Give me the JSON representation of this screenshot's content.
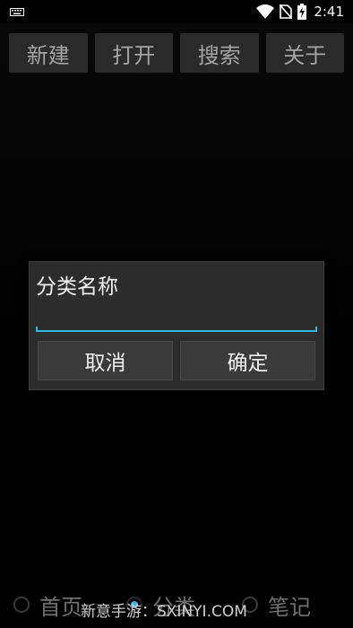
{
  "status_bar": {
    "time": "2:41",
    "icons": [
      "keyboard-icon",
      "wifi-icon",
      "no-sim-icon",
      "battery-charging-icon"
    ]
  },
  "toolbar": {
    "buttons": [
      {
        "label": "新建"
      },
      {
        "label": "打开"
      },
      {
        "label": "搜索"
      },
      {
        "label": "关于"
      }
    ]
  },
  "dialog": {
    "title": "分类名称",
    "input_value": "",
    "cancel_label": "取消",
    "ok_label": "确定",
    "accent_color": "#33b5e5"
  },
  "bottom_tabs": {
    "items": [
      {
        "label": "首页",
        "selected": false
      },
      {
        "label": "分类",
        "selected": true
      },
      {
        "label": "笔记",
        "selected": false
      }
    ]
  },
  "watermark": {
    "text": "新意手游：SXINYI.COM"
  }
}
